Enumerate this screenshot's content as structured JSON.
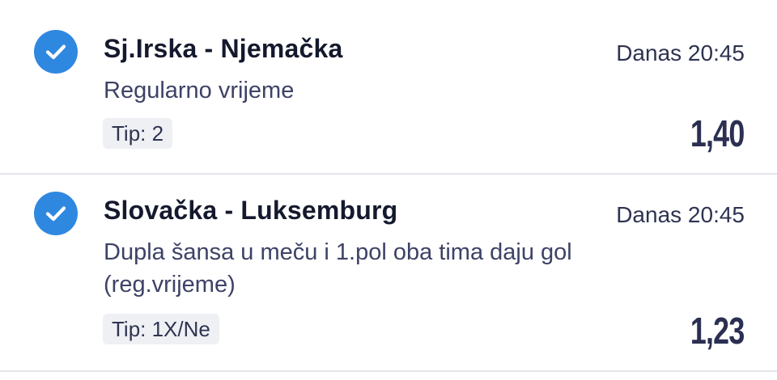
{
  "bets": [
    {
      "match": "Sj.Irska - Njemačka",
      "time": "Danas 20:45",
      "market": "Regularno vrijeme",
      "tip": "Tip: 2",
      "odds": "1,40",
      "icon": "checkmark-icon",
      "accent": "#2f88e0"
    },
    {
      "match": "Slovačka - Luksemburg",
      "time": "Danas 20:45",
      "market": "Dupla šansa u meču i 1.pol oba tima daju gol (reg.vrijeme)",
      "tip": "Tip: 1X/Ne",
      "odds": "1,23",
      "icon": "checkmark-icon",
      "accent": "#2f88e0"
    }
  ]
}
